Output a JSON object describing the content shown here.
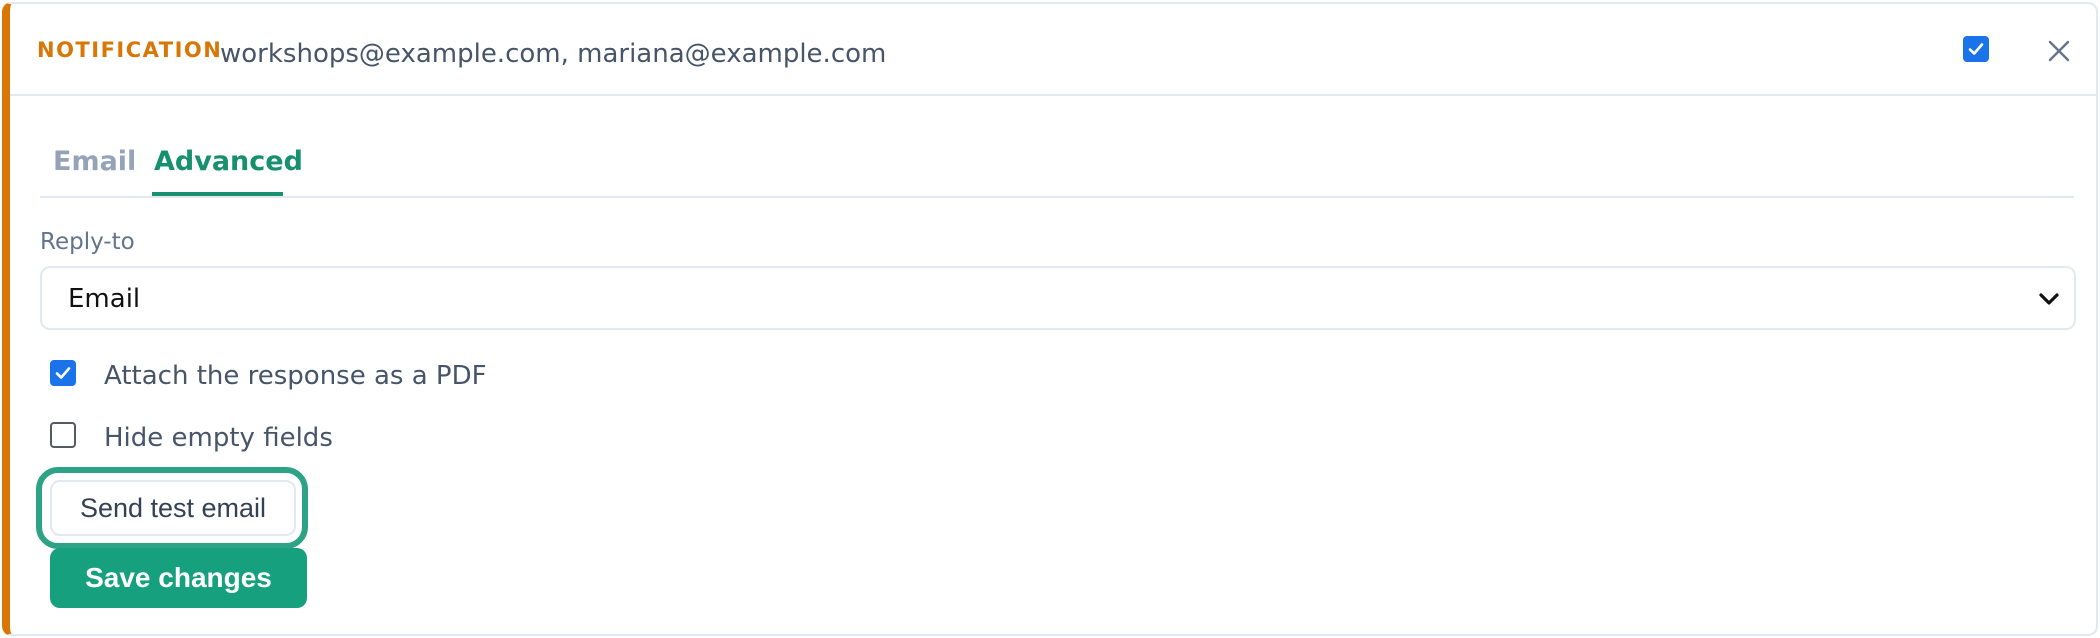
{
  "header": {
    "label": "NOTIFICATION",
    "recipients": "workshops@example.com, mariana@example.com",
    "enabled": true
  },
  "tabs": [
    {
      "label": "Email",
      "active": false
    },
    {
      "label": "Advanced",
      "active": true
    }
  ],
  "reply_to": {
    "label": "Reply-to",
    "selected": "Email"
  },
  "options": [
    {
      "label": "Attach the response as a PDF",
      "checked": true
    },
    {
      "label": "Hide empty fields",
      "checked": false
    }
  ],
  "buttons": {
    "send_test": "Send test email",
    "save": "Save changes"
  },
  "colors": {
    "accent": "#d97706",
    "tab_active": "#16906f",
    "primary": "#16a07e",
    "focus_ring": "#2da287",
    "checkbox": "#1a73e8"
  }
}
